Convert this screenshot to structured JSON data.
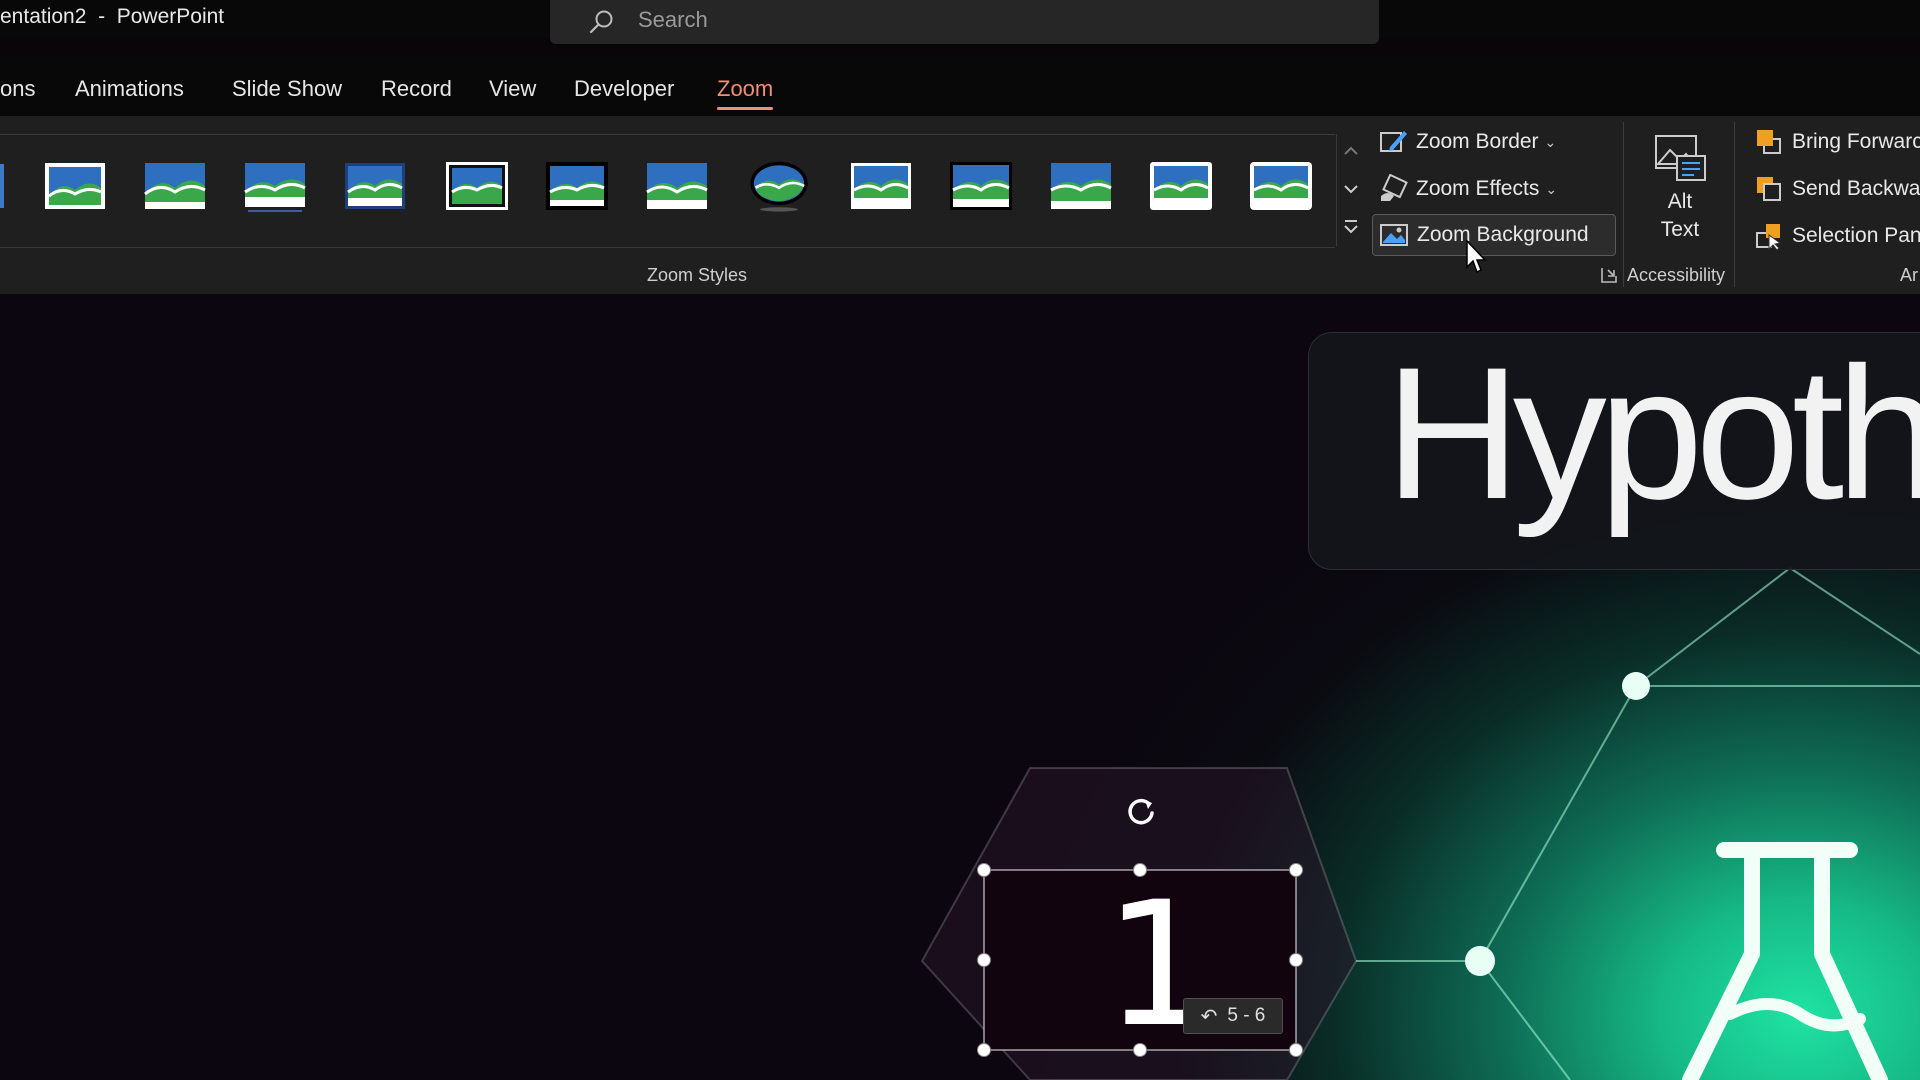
{
  "titlebar": {
    "title": "entation2  -  PowerPoint",
    "search_placeholder": "Search"
  },
  "menu": {
    "tabs": [
      {
        "label": "ons"
      },
      {
        "label": "Animations"
      },
      {
        "label": "Slide Show"
      },
      {
        "label": "Record"
      },
      {
        "label": "View"
      },
      {
        "label": "Developer"
      },
      {
        "label": "Zoom"
      }
    ],
    "active": "Zoom"
  },
  "ribbon": {
    "zoom_styles_label": "Zoom Styles",
    "zoom_border": "Zoom Border",
    "zoom_effects": "Zoom Effects",
    "zoom_background": "Zoom Background",
    "alt_text_line1": "Alt",
    "alt_text_line2": "Text",
    "accessibility_label": "Accessibility",
    "bring_forward": "Bring Forwarc",
    "send_backward": "Send Backwar",
    "selection_pane": "Selection Pane",
    "arrange_label": "Ar"
  },
  "slide": {
    "title_text": "Hypoth",
    "zoom_number": "1",
    "zoom_range": "5 - 6"
  },
  "colors": {
    "accent_tab": "#f08f73",
    "glow": "#1fe3a3",
    "ribbon_bg": "#1f1f1f"
  },
  "icons": [
    "search-icon",
    "zoom-border-icon",
    "zoom-effects-icon",
    "zoom-background-icon",
    "alt-text-icon",
    "bring-forward-icon",
    "send-backward-icon",
    "selection-pane-icon",
    "rotate-handle-icon",
    "return-arrow-icon",
    "flask-icon",
    "dialog-launcher-icon",
    "mouse-pointer-icon"
  ]
}
